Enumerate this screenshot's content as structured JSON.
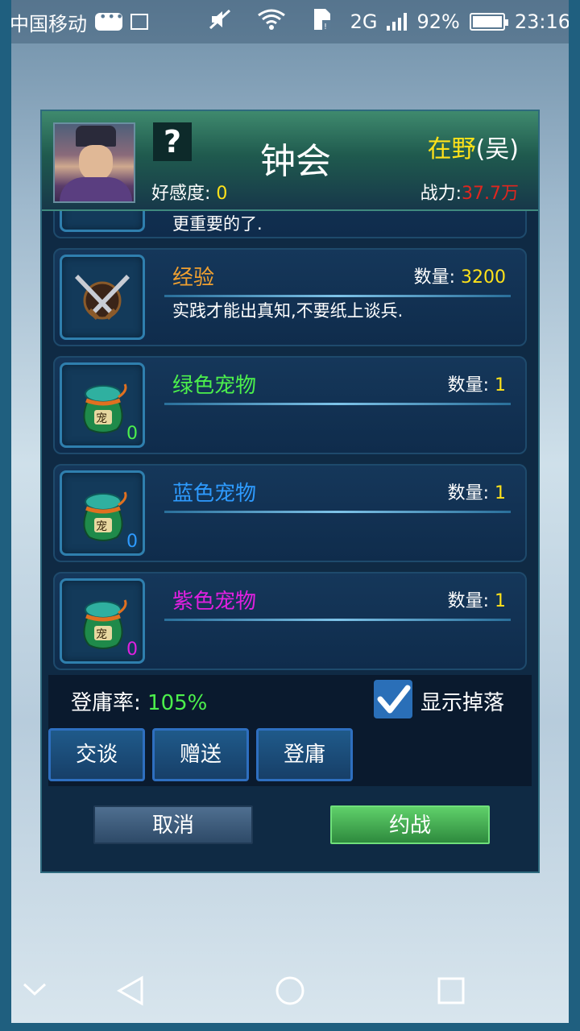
{
  "status_bar": {
    "carrier": "中国移动",
    "network": "2G",
    "battery": "92%",
    "time": "23:16"
  },
  "header": {
    "name": "钟会",
    "faction_main": "在野",
    "faction_paren": "(吴)",
    "affinity_label": "好感度:",
    "affinity_value": "0",
    "power_label": "战力:",
    "power_value": "37.7万",
    "unknown_icon": "?"
  },
  "items": [
    {
      "title": "",
      "desc": "更重要的了.",
      "qty_label": "",
      "qty": ""
    },
    {
      "title": "经验",
      "title_color": "#f0a030",
      "desc": "实践才能出真知,不要纸上谈兵.",
      "qty_label": "数量:",
      "qty": "3200",
      "icon": "crossed-swords-icon"
    },
    {
      "title": "绿色宠物",
      "title_color": "#4cf04c",
      "desc": "",
      "qty_label": "数量:",
      "qty": "1",
      "count": "0",
      "count_color": "#4cf04c",
      "icon": "pet-bag-icon"
    },
    {
      "title": "蓝色宠物",
      "title_color": "#2e9bff",
      "desc": "",
      "qty_label": "数量:",
      "qty": "1",
      "count": "0",
      "count_color": "#2e9bff",
      "icon": "pet-bag-icon"
    },
    {
      "title": "紫色宠物",
      "title_color": "#e020e0",
      "desc": "",
      "qty_label": "数量:",
      "qty": "1",
      "count": "0",
      "count_color": "#e020e0",
      "icon": "pet-bag-icon"
    }
  ],
  "bottom": {
    "rate_label": "登庸率:",
    "rate_value": "105%",
    "show_drops_label": "显示掉落",
    "show_drops_checked": true,
    "actions": [
      "交谈",
      "赠送",
      "登庸"
    ],
    "cancel": "取消",
    "fight": "约战"
  },
  "colors": {
    "yellow": "#ffe21a",
    "red": "#e0261f",
    "green": "#4cf04c"
  }
}
